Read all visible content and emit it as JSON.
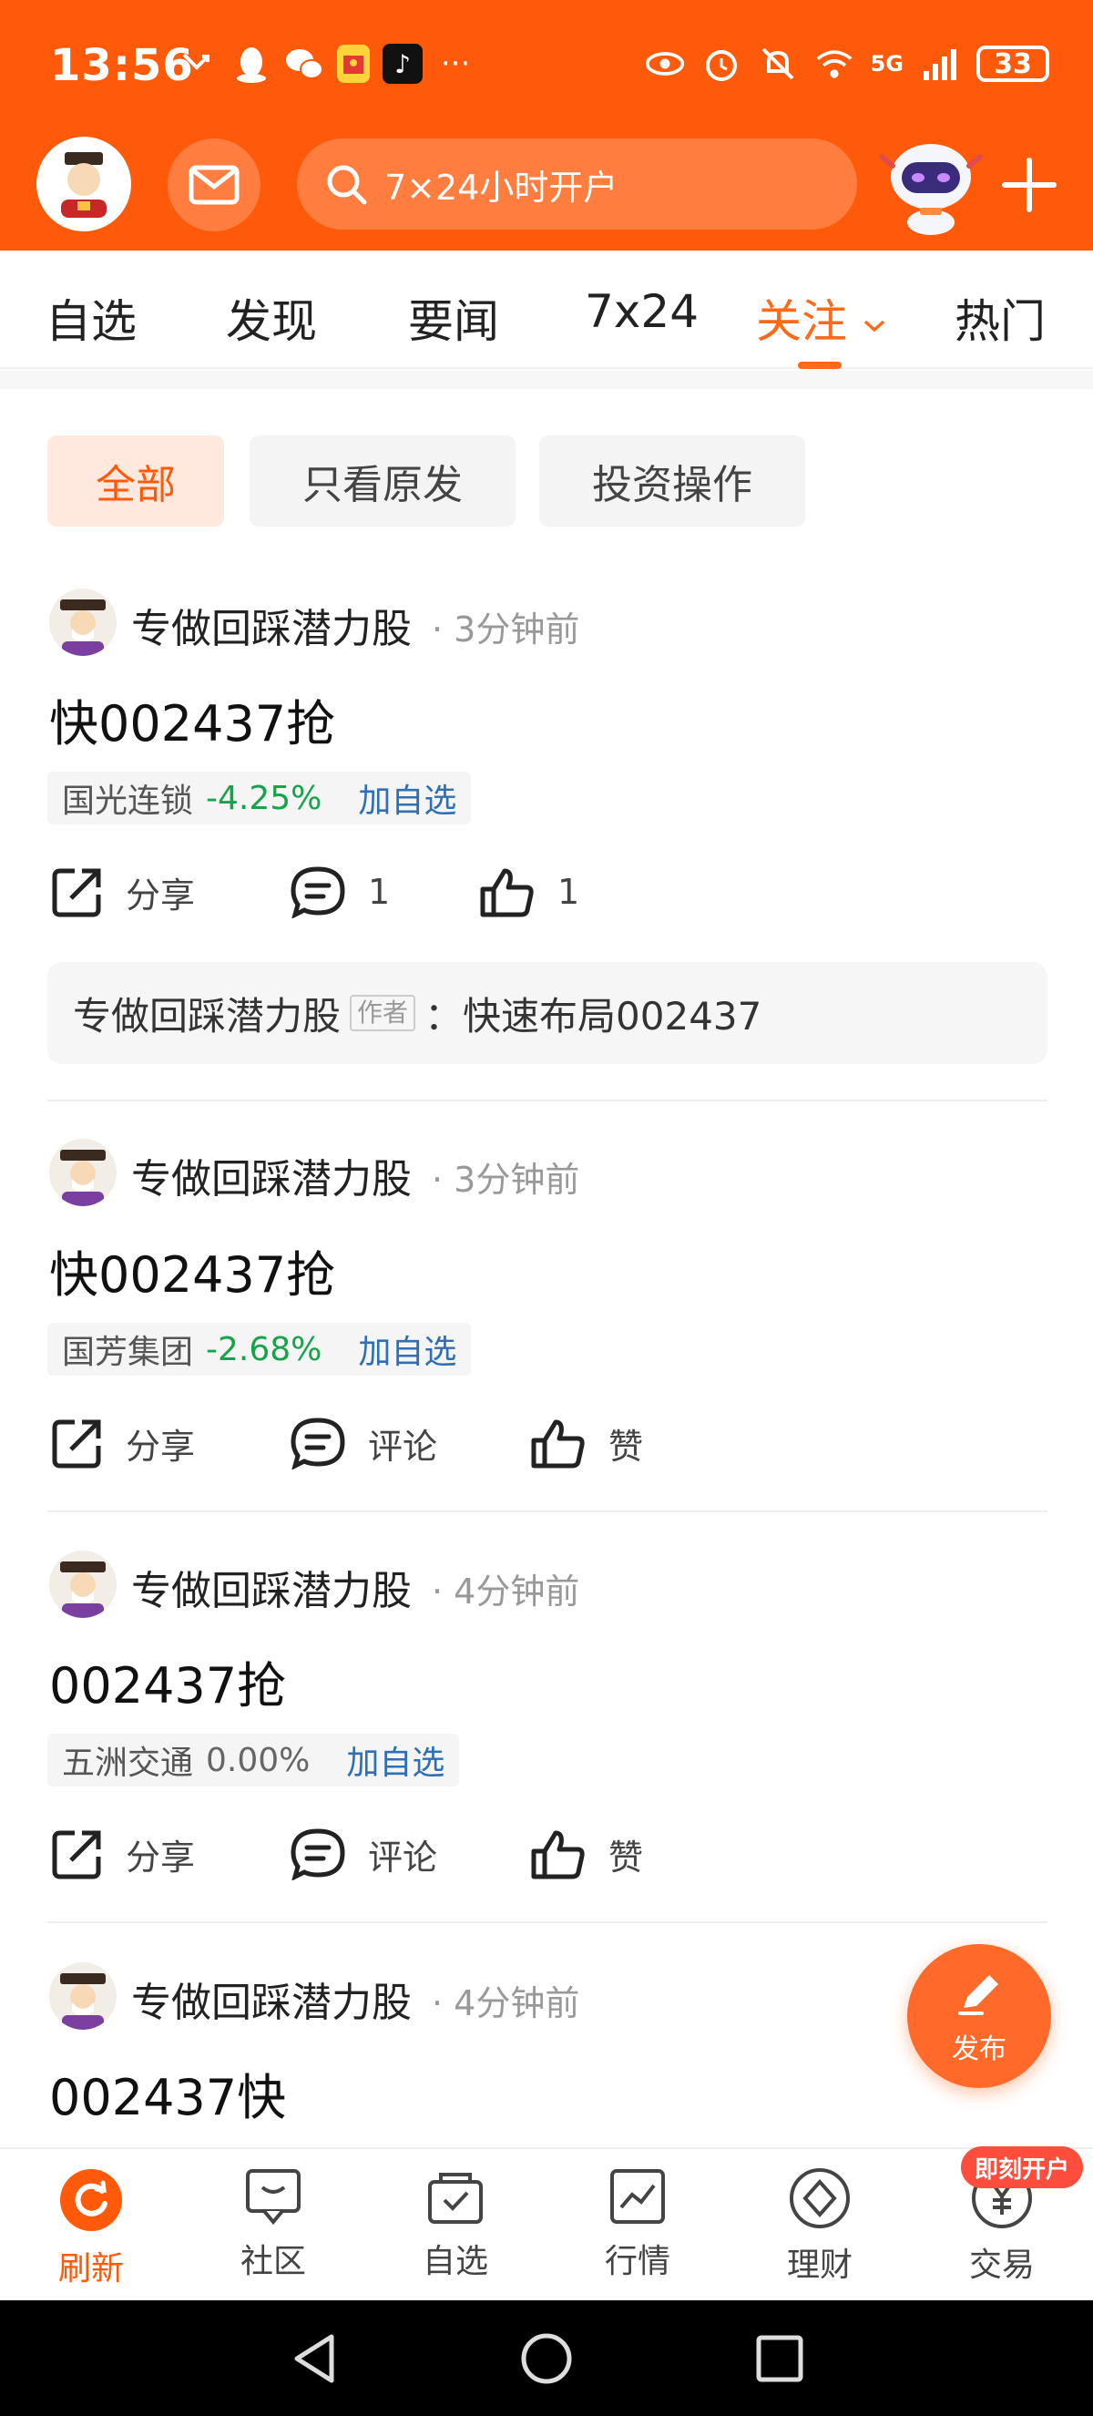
{
  "status_bar": {
    "time": "13:56",
    "battery": "33",
    "network": "5G"
  },
  "search": {
    "placeholder": "7×24小时开户"
  },
  "tabs": [
    {
      "label": "自选"
    },
    {
      "label": "发现"
    },
    {
      "label": "要闻"
    },
    {
      "label": "7x24"
    },
    {
      "label": "关注",
      "active": true
    },
    {
      "label": "热门"
    }
  ],
  "filters": [
    {
      "label": "全部",
      "active": true
    },
    {
      "label": "只看原发"
    },
    {
      "label": "投资操作"
    }
  ],
  "posts": [
    {
      "author": "专做回踩潜力股",
      "time": "· 3分钟前",
      "content": "快002437抢",
      "stock": {
        "name": "国光连锁",
        "change": "-4.25%",
        "add": "加自选"
      },
      "actions": {
        "share": "分享",
        "comment": "1",
        "like": "1"
      },
      "comment": {
        "author": "专做回踩潜力股",
        "tag": "作者",
        "text": "：快速布局002437"
      }
    },
    {
      "author": "专做回踩潜力股",
      "time": "· 3分钟前",
      "content": "快002437抢",
      "stock": {
        "name": "国芳集团",
        "change": "-2.68%",
        "add": "加自选"
      },
      "actions": {
        "share": "分享",
        "comment": "评论",
        "like": "赞"
      }
    },
    {
      "author": "专做回踩潜力股",
      "time": "· 4分钟前",
      "content": "002437抢",
      "stock": {
        "name": "五洲交通",
        "change": "0.00%",
        "add": "加自选"
      },
      "actions": {
        "share": "分享",
        "comment": "评论",
        "like": "赞"
      }
    },
    {
      "author": "专做回踩潜力股",
      "time": "· 4分钟前",
      "content": "002437快"
    }
  ],
  "fab": {
    "label": "发布"
  },
  "bottom_nav": [
    {
      "label": "刷新",
      "active": true
    },
    {
      "label": "社区"
    },
    {
      "label": "自选"
    },
    {
      "label": "行情"
    },
    {
      "label": "理财"
    },
    {
      "label": "交易"
    }
  ],
  "promo_badge": "即刻开户",
  "colors": {
    "brand": "#ff5a0a",
    "down": "#16a34a",
    "link": "#2f6fb5"
  }
}
